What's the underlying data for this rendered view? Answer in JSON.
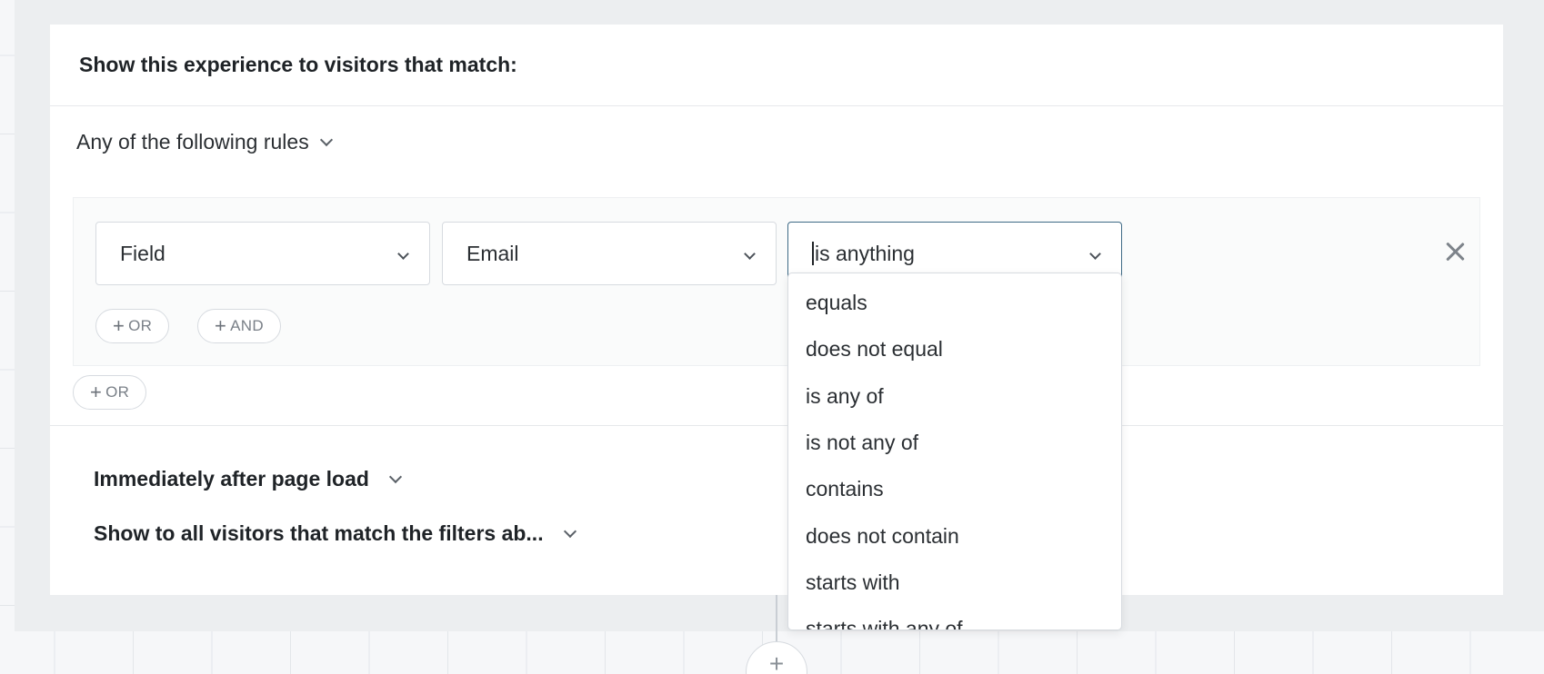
{
  "card": {
    "title": "Show this experience to visitors that match:"
  },
  "rules": {
    "mode_label": "Any of the following rules",
    "field_type": "Field",
    "field_name": "Email",
    "operator": "is anything",
    "add_or_label": "OR",
    "add_and_label": "AND",
    "group_add_or_label": "OR"
  },
  "timing": {
    "trigger_label": "Immediately after page load",
    "audience_label": "Show to all visitors that match the filters ab..."
  },
  "operator_menu": {
    "items": [
      "equals",
      "does not equal",
      "is any of",
      "is not any of",
      "contains",
      "does not contain",
      "starts with",
      "starts with any of"
    ]
  },
  "canvas": {
    "add_step_label": "+"
  }
}
